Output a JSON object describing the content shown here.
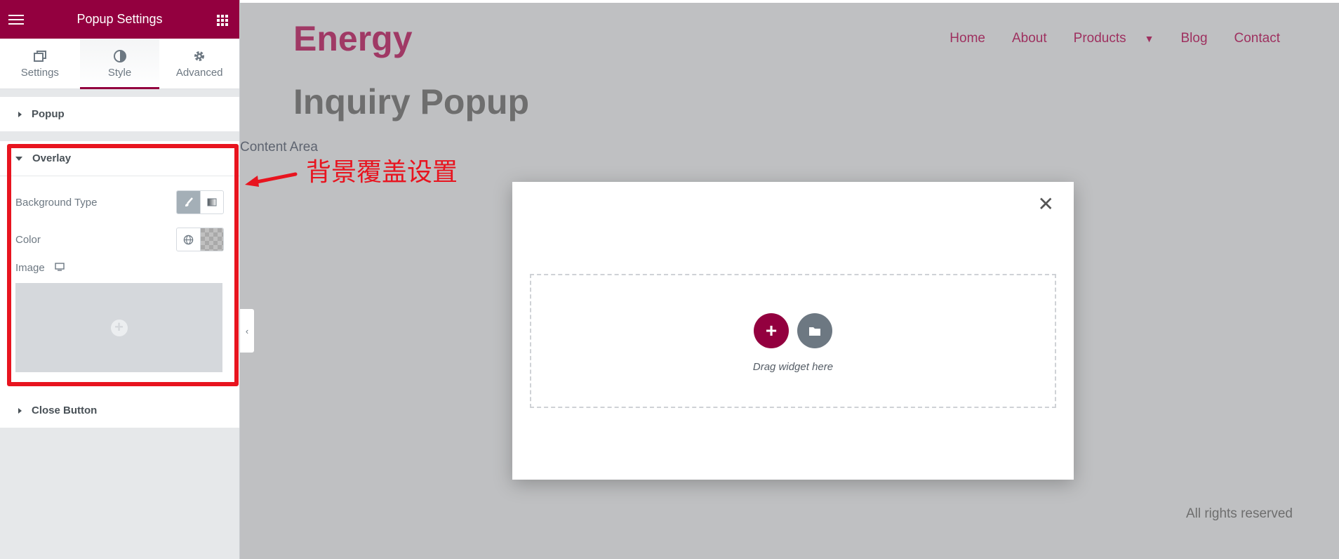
{
  "panel": {
    "title": "Popup Settings",
    "tabs": [
      {
        "label": "Settings",
        "icon": "window-icon"
      },
      {
        "label": "Style",
        "icon": "contrast-icon",
        "active": true
      },
      {
        "label": "Advanced",
        "icon": "gear-icon"
      }
    ],
    "sections": {
      "popup": "Popup",
      "overlay": "Overlay",
      "close_button": "Close Button"
    },
    "overlay": {
      "background_type_label": "Background Type",
      "color_label": "Color",
      "image_label": "Image"
    }
  },
  "annotation": {
    "text": "背景覆盖设置",
    "color": "#e8141f"
  },
  "site": {
    "logo": "Energy",
    "nav": [
      "Home",
      "About",
      "Products",
      "Blog",
      "Contact"
    ],
    "page_title": "Inquiry Popup",
    "content_area": "Content Area",
    "footer": "All rights reserved",
    "brand_color": "#93003f"
  },
  "popup": {
    "dropzone_label": "Drag widget here",
    "close_symbol": "✕"
  }
}
